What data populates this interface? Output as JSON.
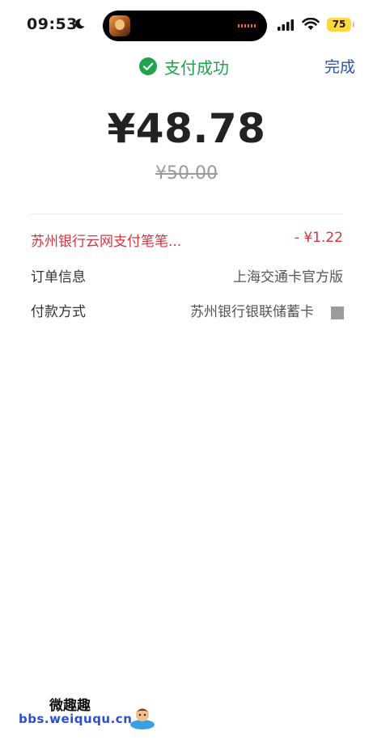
{
  "status_bar": {
    "time": "09:53",
    "battery": "75",
    "icons": [
      "moon-icon",
      "signal-icon",
      "wifi-icon",
      "battery-icon"
    ]
  },
  "header": {
    "success_text": "支付成功",
    "done_label": "完成",
    "success_color": "#1fa34c",
    "link_color": "#1f56b8"
  },
  "payment": {
    "amount": "¥48.78",
    "original_amount": "¥50.00"
  },
  "details": [
    {
      "label": "苏州银行云网支付笔笔...",
      "value": "- ¥1.22",
      "type": "discount"
    },
    {
      "label": "订单信息",
      "value": "上海交通卡官方版",
      "type": "normal"
    },
    {
      "label": "付款方式",
      "value": "苏州银行银联储蓄卡",
      "type": "normal"
    }
  ],
  "watermark": {
    "title": "微趣趣",
    "url": "bbs.weiququ.cn"
  },
  "colors": {
    "discount": "#d8343f",
    "battery": "#ffd83d"
  }
}
